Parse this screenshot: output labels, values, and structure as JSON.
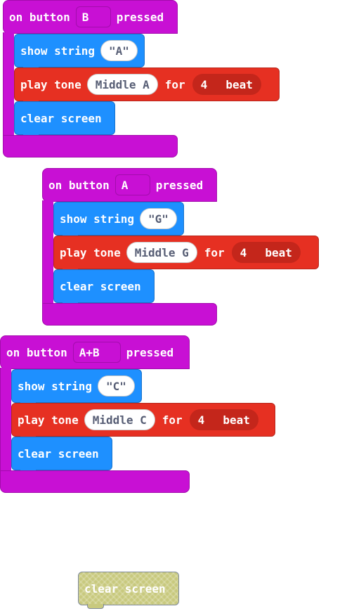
{
  "events": [
    {
      "prefix": "on button",
      "button": "B",
      "suffix": "pressed",
      "show_label": "show string",
      "show_value": "\"A\"",
      "tone_label": "play tone",
      "note": "Middle A",
      "for_label": "for",
      "beats": "4",
      "beat_label": "beat",
      "clear_label": "clear screen"
    },
    {
      "prefix": "on button",
      "button": "A",
      "suffix": "pressed",
      "show_label": "show string",
      "show_value": "\"G\"",
      "tone_label": "play tone",
      "note": "Middle G",
      "for_label": "for",
      "beats": "4",
      "beat_label": "beat",
      "clear_label": "clear screen"
    },
    {
      "prefix": "on button",
      "button": "A+B",
      "suffix": "pressed",
      "show_label": "show string",
      "show_value": "\"C\"",
      "tone_label": "play tone",
      "note": "Middle C",
      "for_label": "for",
      "beats": "4",
      "beat_label": "beat",
      "clear_label": "clear screen"
    }
  ],
  "dragging_block": {
    "label": "clear screen"
  },
  "colors": {
    "event_block": "#c810d4",
    "basic_block": "#1e90ff",
    "music_block": "#e63022",
    "ghost_block": "#c8c97e"
  }
}
